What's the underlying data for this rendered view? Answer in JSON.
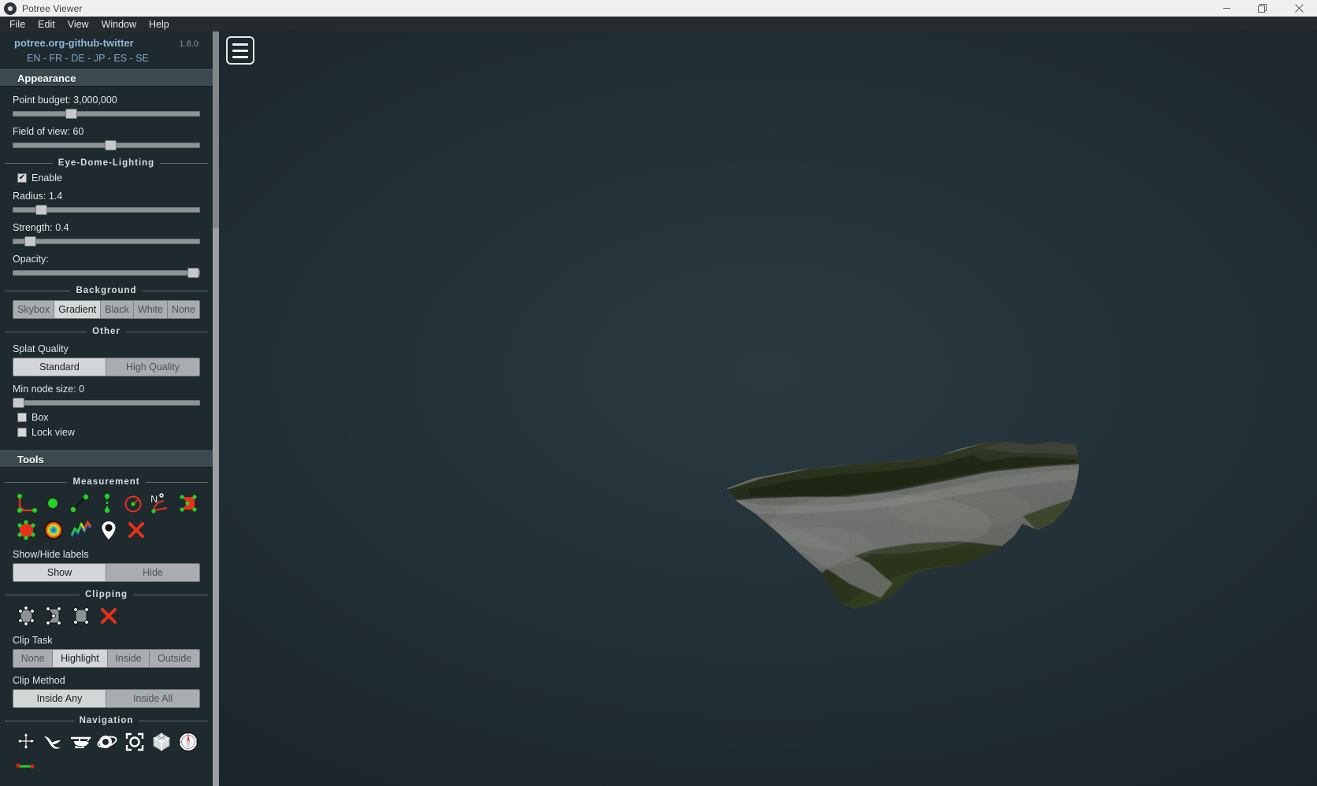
{
  "window": {
    "title": "Potree Viewer",
    "app_icon": "potree-logo-icon",
    "controls": {
      "minimize": "minimize-icon",
      "maximize": "maximize-icon",
      "close": "close-icon"
    }
  },
  "menubar": {
    "items": [
      "File",
      "Edit",
      "View",
      "Window",
      "Help"
    ]
  },
  "sidebar": {
    "brand": {
      "site": "potree.org",
      "github": "github",
      "twitter": "twitter",
      "separator": "-",
      "version": "1.8.0"
    },
    "languages": [
      "EN",
      "FR",
      "DE",
      "JP",
      "ES",
      "SE"
    ],
    "language_separator": "-",
    "appearance": {
      "header": "Appearance",
      "point_budget_label": "Point budget: 3,000,000",
      "point_budget_percent": 30,
      "fov_label": "Field of view: 60",
      "fov_percent": 50,
      "edl": {
        "title": "Eye-Dome-Lighting",
        "enable_label": "Enable",
        "enable_checked": true,
        "radius_label": "Radius: 1.4",
        "radius_percent": 14,
        "strength_label": "Strength: 0.4",
        "strength_percent": 7,
        "opacity_label": "Opacity:",
        "opacity_percent": 100
      },
      "background": {
        "title": "Background",
        "options": [
          "Skybox",
          "Gradient",
          "Black",
          "White",
          "None"
        ],
        "selected": "Gradient"
      },
      "other": {
        "title": "Other",
        "splat_quality_label": "Splat Quality",
        "splat_quality_options": [
          "Standard",
          "High Quality"
        ],
        "splat_quality_selected": "Standard",
        "min_node_size_label": "Min node size: 0",
        "min_node_size_percent": 0,
        "box_label": "Box",
        "box_checked": false,
        "lock_view_label": "Lock view",
        "lock_view_checked": false
      }
    },
    "tools": {
      "header": "Tools",
      "measurement": {
        "title": "Measurement",
        "row1_icons": [
          "angle-measure-icon",
          "point-measure-icon",
          "distance-measure-icon",
          "height-measure-icon",
          "circle-measure-icon",
          "azimuth-measure-icon",
          "area-measure-icon"
        ],
        "row2_icons": [
          "volume-box-icon",
          "volume-sphere-icon",
          "height-profile-icon",
          "annotation-pin-icon",
          "remove-measurements-icon"
        ],
        "labels_label": "Show/Hide labels",
        "labels_options": [
          "Show",
          "Hide"
        ],
        "labels_selected": "Show"
      },
      "clipping": {
        "title": "Clipping",
        "icons": [
          "clip-volume-icon",
          "clip-polygon-icon",
          "clip-plane-icon",
          "remove-clip-icon"
        ],
        "clip_task_label": "Clip Task",
        "clip_task_options": [
          "None",
          "Highlight",
          "Inside",
          "Outside"
        ],
        "clip_task_selected": "Highlight",
        "clip_method_label": "Clip Method",
        "clip_method_options": [
          "Inside Any",
          "Inside All"
        ],
        "clip_method_selected": "Inside Any"
      },
      "navigation": {
        "title": "Navigation",
        "icons": [
          "earth-controls-icon",
          "fly-controls-icon",
          "helicopter-controls-icon",
          "orbit-controls-icon",
          "focus-view-icon",
          "full-extent-icon",
          "compass-icon"
        ]
      }
    }
  },
  "viewport": {
    "menu_button": "hamburger-menu-icon",
    "scene": "aerial-point-cloud-riverbed"
  },
  "colors": {
    "panel_bg": "#1e2a2e",
    "accordion_bg": "#3b4a4f",
    "link": "#8fb6da",
    "text": "#dfe6e7",
    "button": "#a9adaf",
    "button_active": "#d3d6d7",
    "measure_red": "#e8301c",
    "measure_green": "#22d422",
    "titlebar": "#f0f0f0"
  }
}
